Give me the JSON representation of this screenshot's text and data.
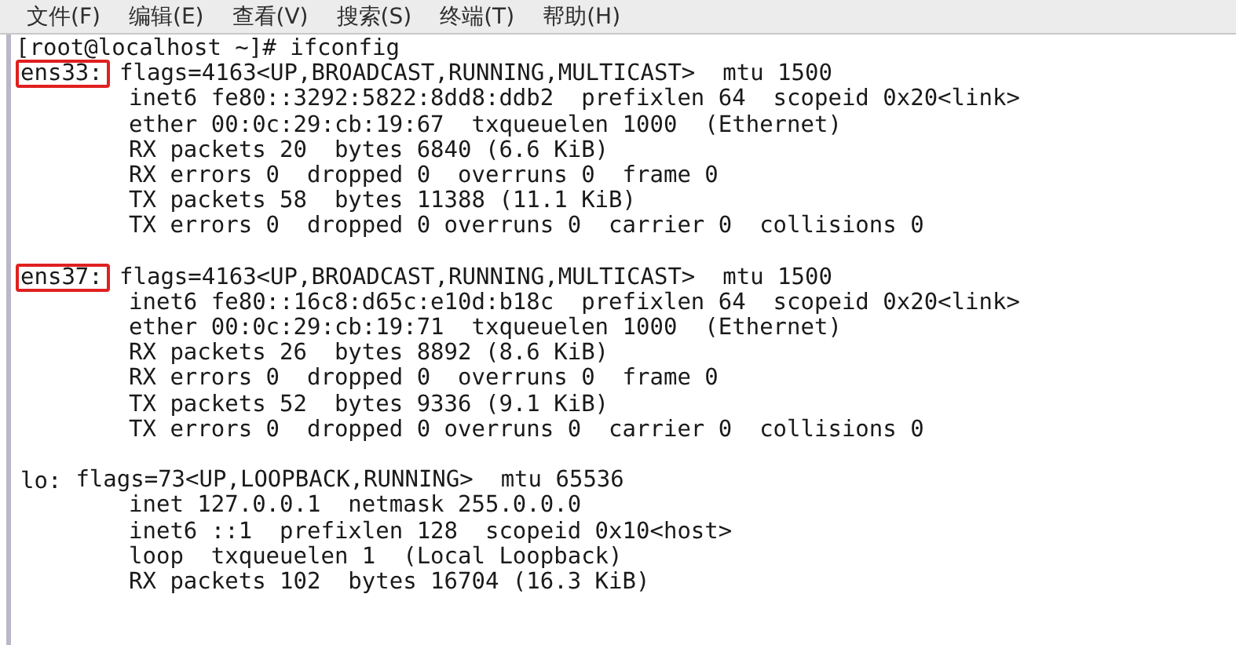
{
  "menu_bar": [
    "文件(F)",
    "编辑(E)",
    "查看(V)",
    "搜索(S)",
    "终端(T)",
    "帮助(H)"
  ],
  "terminal": {
    "prompt": "[root@localhost ~]# ifconfig",
    "interfaces": [
      {
        "name": "ens33:",
        "highlighted": true,
        "header": "flags=4163<UP,BROADCAST,RUNNING,MULTICAST>  mtu 1500",
        "details": [
          "inet6 fe80::3292:5822:8dd8:ddb2  prefixlen 64  scopeid 0x20<link>",
          "ether 00:0c:29:cb:19:67  txqueuelen 1000  (Ethernet)",
          "RX packets 20  bytes 6840 (6.6 KiB)",
          "RX errors 0  dropped 0  overruns 0  frame 0",
          "TX packets 58  bytes 11388 (11.1 KiB)",
          "TX errors 0  dropped 0 overruns 0  carrier 0  collisions 0"
        ]
      },
      {
        "name": "ens37:",
        "highlighted": true,
        "header": "flags=4163<UP,BROADCAST,RUNNING,MULTICAST>  mtu 1500",
        "details": [
          "inet6 fe80::16c8:d65c:e10d:b18c  prefixlen 64  scopeid 0x20<link>",
          "ether 00:0c:29:cb:19:71  txqueuelen 1000  (Ethernet)",
          "RX packets 26  bytes 8892 (8.6 KiB)",
          "RX errors 0  dropped 0  overruns 0  frame 0",
          "TX packets 52  bytes 9336 (9.1 KiB)",
          "TX errors 0  dropped 0 overruns 0  carrier 0  collisions 0"
        ]
      },
      {
        "name": "lo:",
        "highlighted": false,
        "header": "flags=73<UP,LOOPBACK,RUNNING>  mtu 65536",
        "details": [
          "inet 127.0.0.1  netmask 255.0.0.0",
          "inet6 ::1  prefixlen 128  scopeid 0x10<host>",
          "loop  txqueuelen 1  (Local Loopback)",
          "RX packets 102  bytes 16704 (16.3 KiB)"
        ]
      }
    ]
  }
}
